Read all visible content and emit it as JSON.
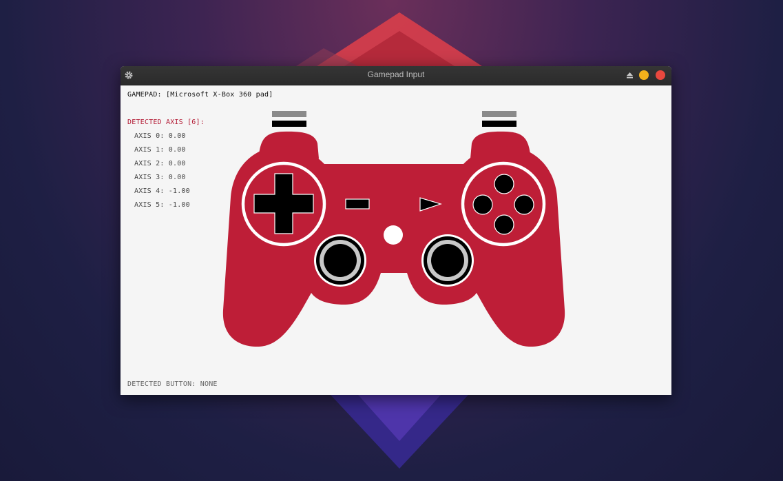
{
  "window": {
    "title": "Gamepad Input"
  },
  "titlebar_icons": {
    "left": "gear-icon",
    "right": [
      "eject-icon",
      "minimize-button",
      "close-button"
    ]
  },
  "gamepad": {
    "label": "GAMEPAD: [Microsoft X-Box 360 pad]"
  },
  "axes": {
    "title": "DETECTED AXIS [6]:",
    "rows": [
      "AXIS 0: 0.00",
      "AXIS 1: 0.00",
      "AXIS 2: 0.00",
      "AXIS 3: 0.00",
      "AXIS 4: -1.00",
      "AXIS 5: -1.00"
    ]
  },
  "status": {
    "detected_button": "DETECTED BUTTON: NONE"
  },
  "colors": {
    "controller": "#be1e37",
    "accent_text": "#b31b35",
    "minimize": "#f3b01b",
    "close": "#e8483e"
  }
}
